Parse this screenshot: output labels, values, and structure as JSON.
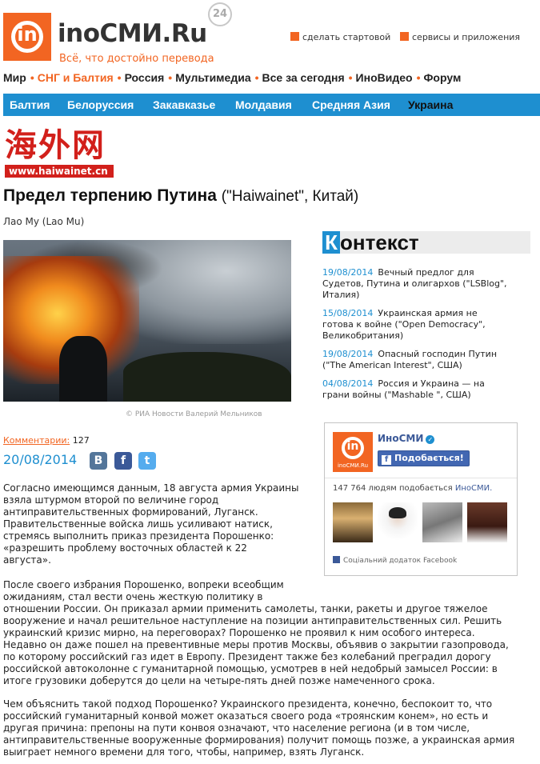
{
  "header": {
    "logo_letter": "in",
    "logo_text": "inoСМИ.Ru",
    "tagline": "Всё, что достойно перевода",
    "age_badge": "24",
    "link_start_page": "сделать стартовой",
    "link_services": "сервисы и приложения"
  },
  "main_nav": [
    "Мир",
    "СНГ и Балтия",
    "Россия",
    "Мультимедиа",
    "Все за сегодня",
    "ИноВидео",
    "Форум"
  ],
  "sub_nav": [
    "Балтия",
    "Белоруссия",
    "Закавказье",
    "Молдавия",
    "Средняя Азия",
    "Украина"
  ],
  "source_logo": {
    "chinese": "海外网",
    "url": "www.haiwainet.cn"
  },
  "article": {
    "title": "Предел терпению Путина",
    "source": "(\"Haiwainet\", Китай)",
    "author": "Лао Му (Lao Mu)",
    "photo_credit": "©  РИА Новости Валерий Мельников",
    "comments_label": "Комментарии:",
    "comments_count": "127",
    "date": "20/08/2014",
    "paragraphs": [
      [
        "Согласно имеющимся данным, 18 августа армия Украины",
        "взяла штурмом второй по величине город",
        "антиправительственных формирований, Луганск.",
        "Правительственные войска лишь усиливают натиск,",
        "стремясь выполнить приказ президента Порошенко:",
        "«разрешить проблему восточных областей к 22",
        "августа»."
      ],
      [
        "После своего избрания Порошенко, вопреки всеобщим",
        "ожиданиям, стал вести очень жесткую политику в",
        "отношении России. Он приказал армии применить самолеты, танки, ракеты и другое тяжелое",
        "вооружение и начал решительное наступление на позиции антиправительственных сил. Решить",
        "украинский кризис мирно, на переговорах? Порошенко не проявил к ним особого интереса.",
        "Недавно он даже пошел на превентивные меры против Москвы, объявив о закрытии газопровода,",
        "по которому российский газ идет в Европу. Президент также без колебаний преградил дорогу",
        "российской автоколонне с гуманитарной помощью, усмотрев в ней недобрый замысел России: в",
        "итоге грузовики доберутся до цели на четыре-пять дней позже намеченного срока."
      ],
      [
        "Чем объяснить такой подход Порошенко? Украинского президента, конечно, беспокоит то, что",
        "российский гуманитарный конвой может оказаться своего рода «троянским конем», но есть и",
        "другая причина: препоны на пути конвоя означают, что население региона (и в том числе,",
        "антиправительственные вооруженные формирования) получит помощь позже, а украинская армия",
        "выиграет немного времени для того, чтобы, например, взять Луганск."
      ]
    ]
  },
  "context": {
    "heading_letter": "К",
    "heading_rest": "онтекст",
    "items": [
      {
        "date": "19/08/2014",
        "lines": [
          "Вечный предлог для",
          "Судетов, Путина и олигархов (\"LSBlog\",",
          "Италия)"
        ]
      },
      {
        "date": "15/08/2014",
        "lines": [
          "Украинская армия не",
          "готова к войне (\"Open Democracy\",",
          "Великобритания)"
        ]
      },
      {
        "date": "19/08/2014",
        "lines": [
          "Опасный господин Путин",
          "(\"The American Interest\", США)"
        ]
      },
      {
        "date": "04/08/2014",
        "lines": [
          "Россия и Украина — на",
          "грани войны (\"Mashable \", США)"
        ]
      }
    ]
  },
  "facebook": {
    "logo_caption": "inoСМИ.Ru",
    "page_name": "ИноСМИ",
    "like_button": "Подобається!",
    "like_icon": "f",
    "count_text": "147 764 людям подобається ",
    "count_page": "ИноСМИ.",
    "footer": "Соціальний додаток Facebook"
  },
  "social": {
    "vk": "В",
    "fb": "f",
    "tw": "t"
  }
}
